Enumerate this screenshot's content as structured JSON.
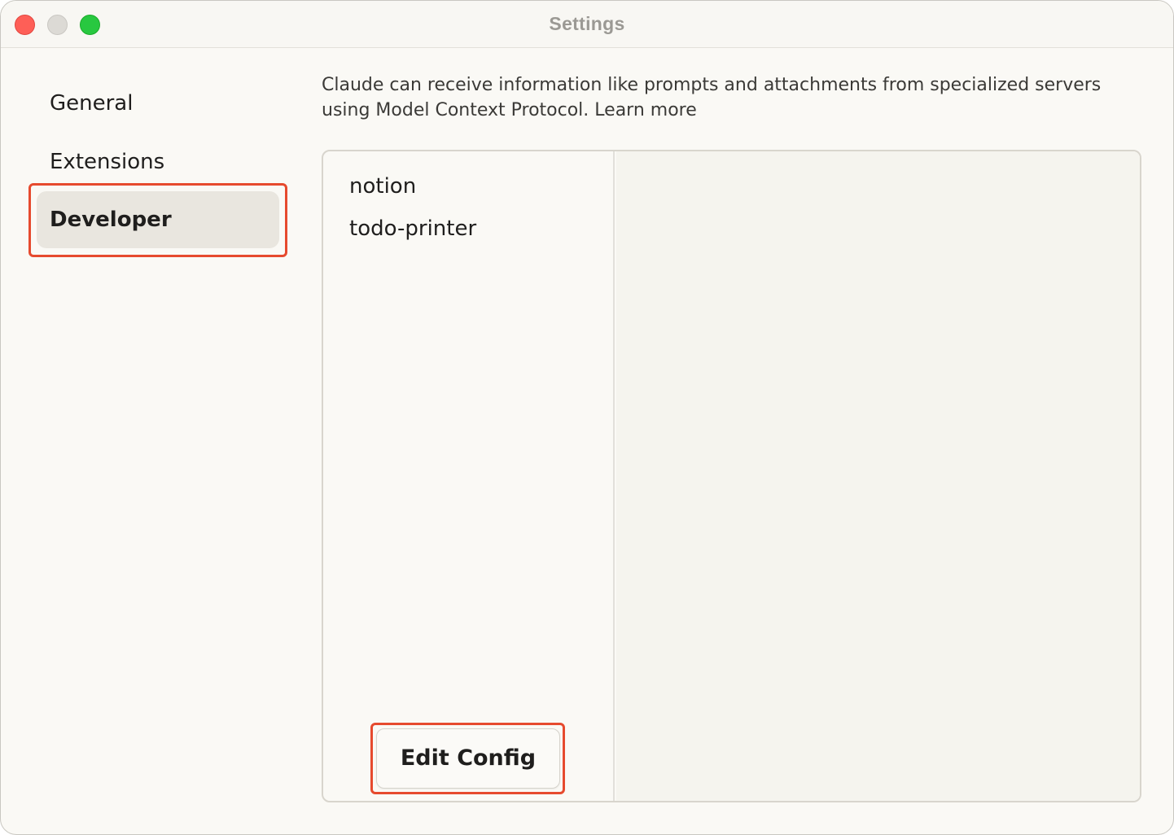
{
  "window": {
    "title": "Settings"
  },
  "sidebar": {
    "items": [
      {
        "label": "General",
        "selected": false
      },
      {
        "label": "Extensions",
        "selected": false
      },
      {
        "label": "Developer",
        "selected": true
      }
    ]
  },
  "main": {
    "description": "Claude can receive information like prompts and attachments from specialized servers using Model Context Protocol. Learn more",
    "servers": [
      {
        "label": "notion"
      },
      {
        "label": "todo-printer"
      }
    ],
    "edit_config_label": "Edit Config"
  },
  "colors": {
    "highlight": "#e64a2e",
    "window_bg": "#faf9f5",
    "selected_bg": "#e9e6df",
    "close": "#fe5f57",
    "minimize": "#dcdad5",
    "zoom": "#28c840"
  }
}
